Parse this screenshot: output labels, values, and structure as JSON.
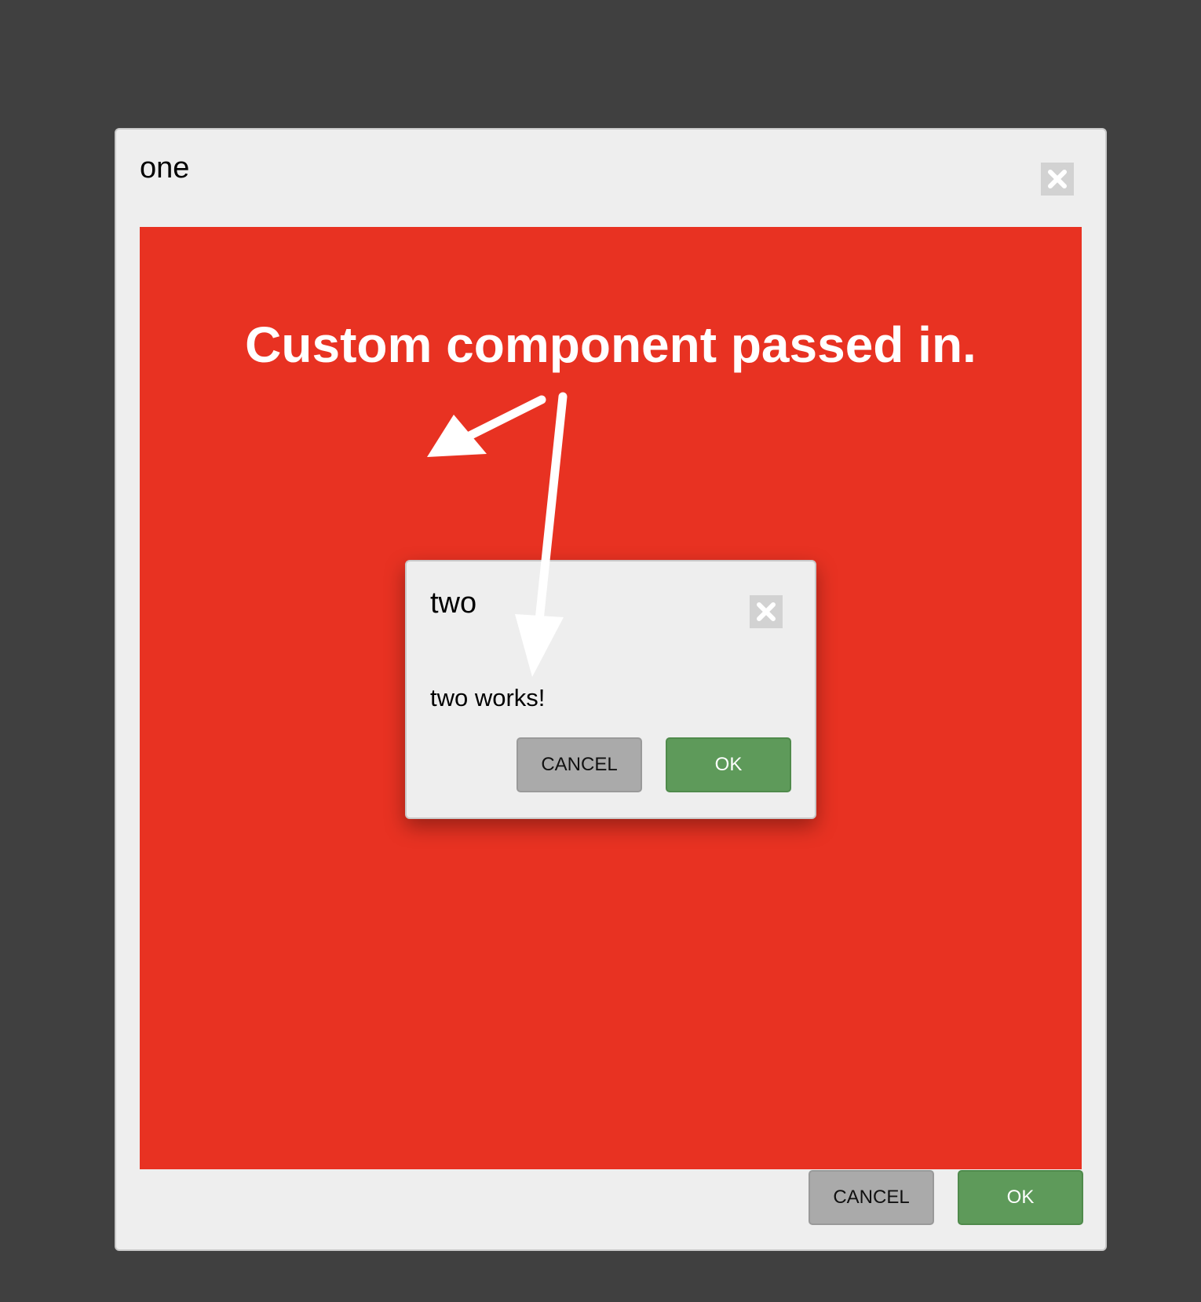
{
  "dialog_one": {
    "title": "one",
    "close_icon": "close-icon",
    "content": {
      "heading": "Custom component passed in.",
      "background": "#e83222"
    },
    "cancel_label": "CANCEL",
    "ok_label": "OK"
  },
  "dialog_two": {
    "title": "two",
    "close_icon": "close-icon",
    "body_text": "two works!",
    "cancel_label": "CANCEL",
    "ok_label": "OK"
  },
  "colors": {
    "backdrop": "#404040",
    "dialog_background": "#eeeeee",
    "cancel_button": "#aaaaaa",
    "ok_button": "#5e9a5a",
    "annotation": "#ffffff"
  }
}
